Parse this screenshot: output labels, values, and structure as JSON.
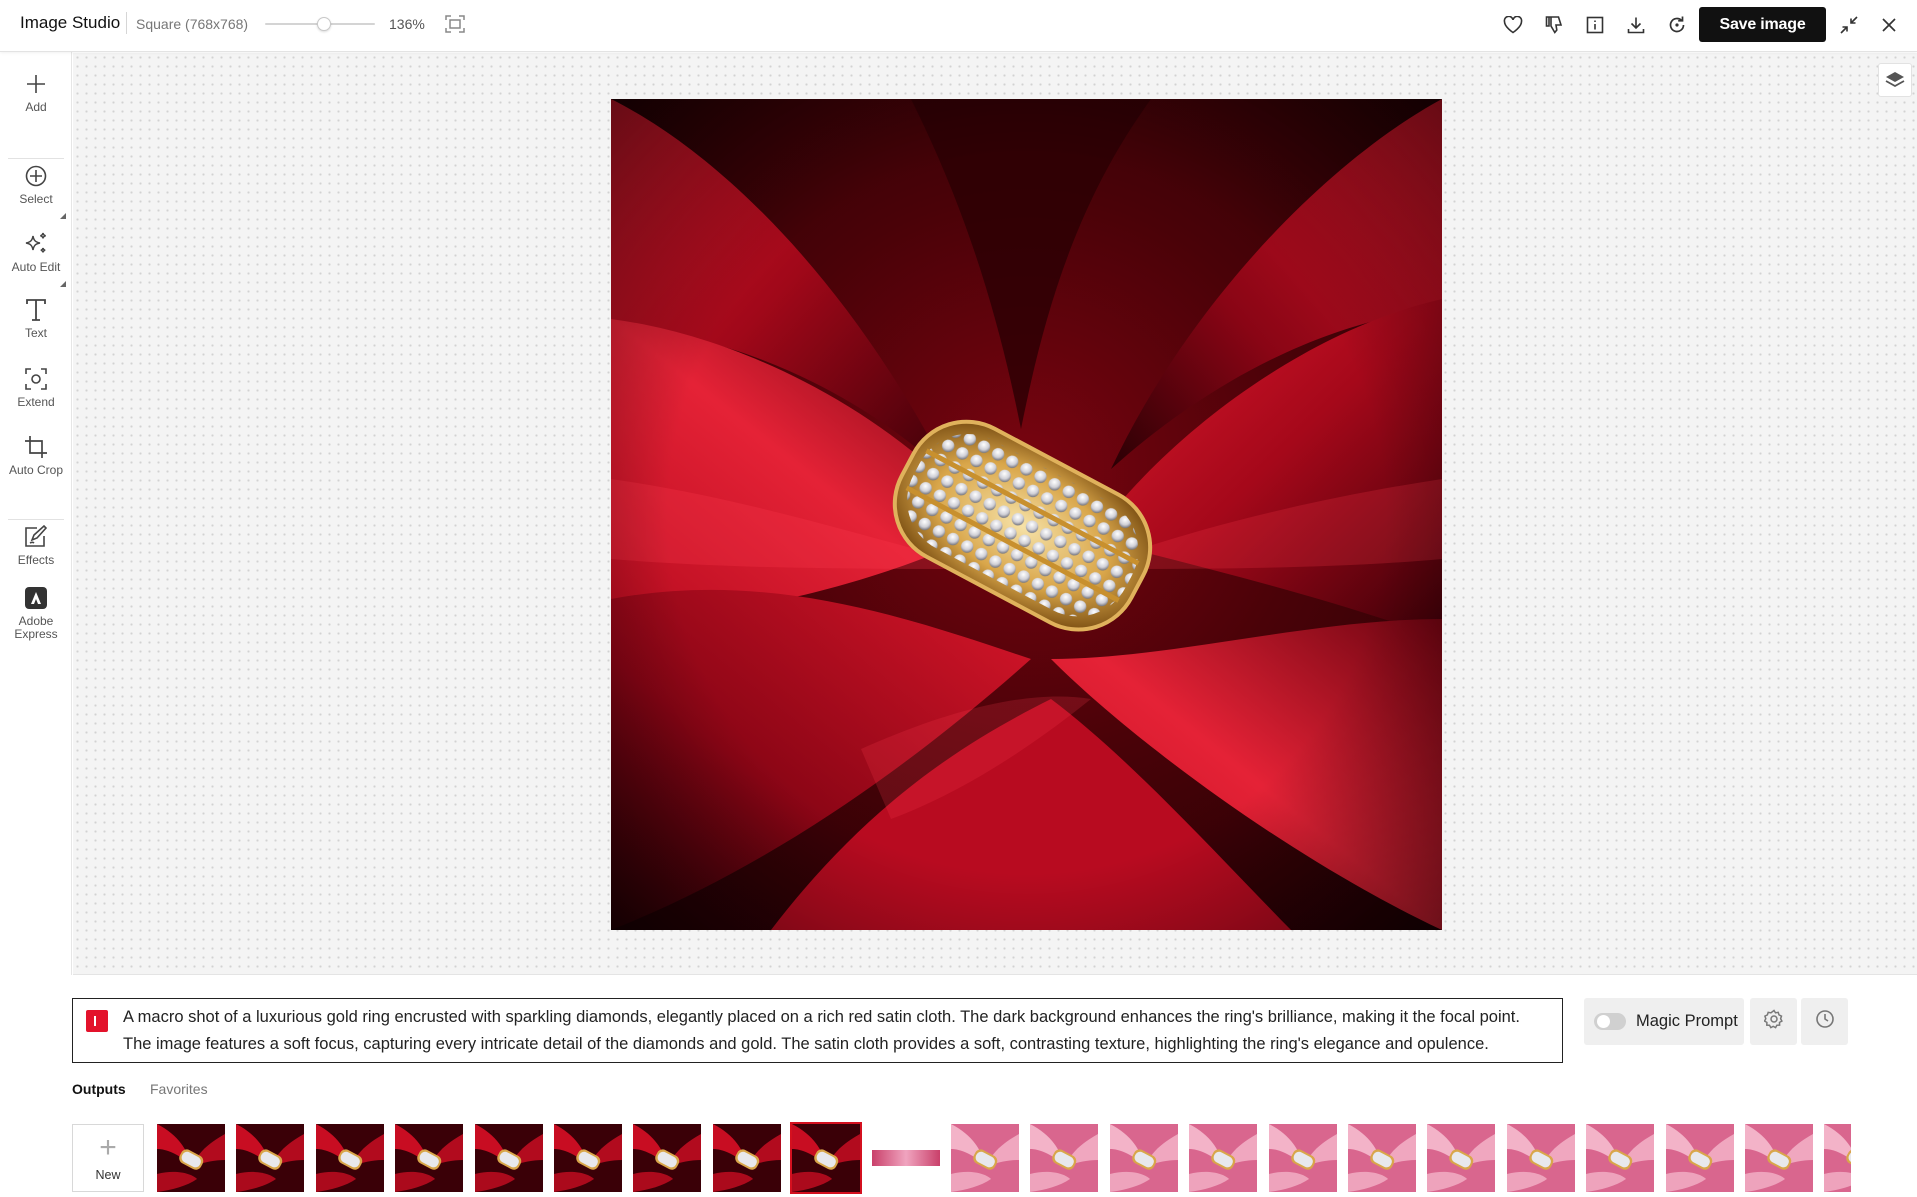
{
  "header": {
    "app_title": "Image Studio",
    "size_label": "Square (768x768)",
    "zoom_percent": "136%",
    "zoom_level": 0.54,
    "save_label": "Save image",
    "icons": [
      "heart-icon",
      "thumbs-down-icon",
      "info-icon",
      "download-icon",
      "regenerate-icon",
      "collapse-icon",
      "close-icon"
    ]
  },
  "sidebar": {
    "items": [
      {
        "label": "Add",
        "icon": "plus-icon"
      },
      {
        "label": "Select",
        "icon": "select-target-icon"
      },
      {
        "label": "Auto Edit",
        "icon": "sparkles-icon"
      },
      {
        "label": "Text",
        "icon": "text-icon"
      },
      {
        "label": "Extend",
        "icon": "extend-icon"
      },
      {
        "label": "Auto Crop",
        "icon": "crop-icon"
      },
      {
        "label": "Effects",
        "icon": "effects-icon"
      },
      {
        "label": "Adobe Express",
        "icon": "adobe-express-icon"
      }
    ]
  },
  "prompt": {
    "text": "A macro shot of a luxurious gold ring encrusted with sparkling diamonds, elegantly placed on a rich red satin cloth. The dark background enhances the ring's brilliance, making it the focal point. The image features a soft focus, capturing every intricate detail of the diamonds and gold. The satin cloth provides a soft, contrasting texture, highlighting the ring's elegance and opulence.",
    "magic_prompt_label": "Magic Prompt",
    "magic_prompt_on": false
  },
  "outputs": {
    "tabs": [
      "Outputs",
      "Favorites"
    ],
    "active_tab": "Outputs",
    "new_label": "New",
    "selected_index": 8,
    "thumbnails": [
      "red",
      "red",
      "red",
      "red",
      "red",
      "red",
      "red",
      "red",
      "red",
      "banner",
      "pink",
      "pink",
      "pink",
      "pink",
      "pink",
      "pink",
      "pink",
      "pink",
      "pink",
      "pink",
      "pink",
      "pink"
    ]
  },
  "colors": {
    "accent": "#e3122b",
    "primary_button": "#111111",
    "satin_red": "#b3081c"
  }
}
